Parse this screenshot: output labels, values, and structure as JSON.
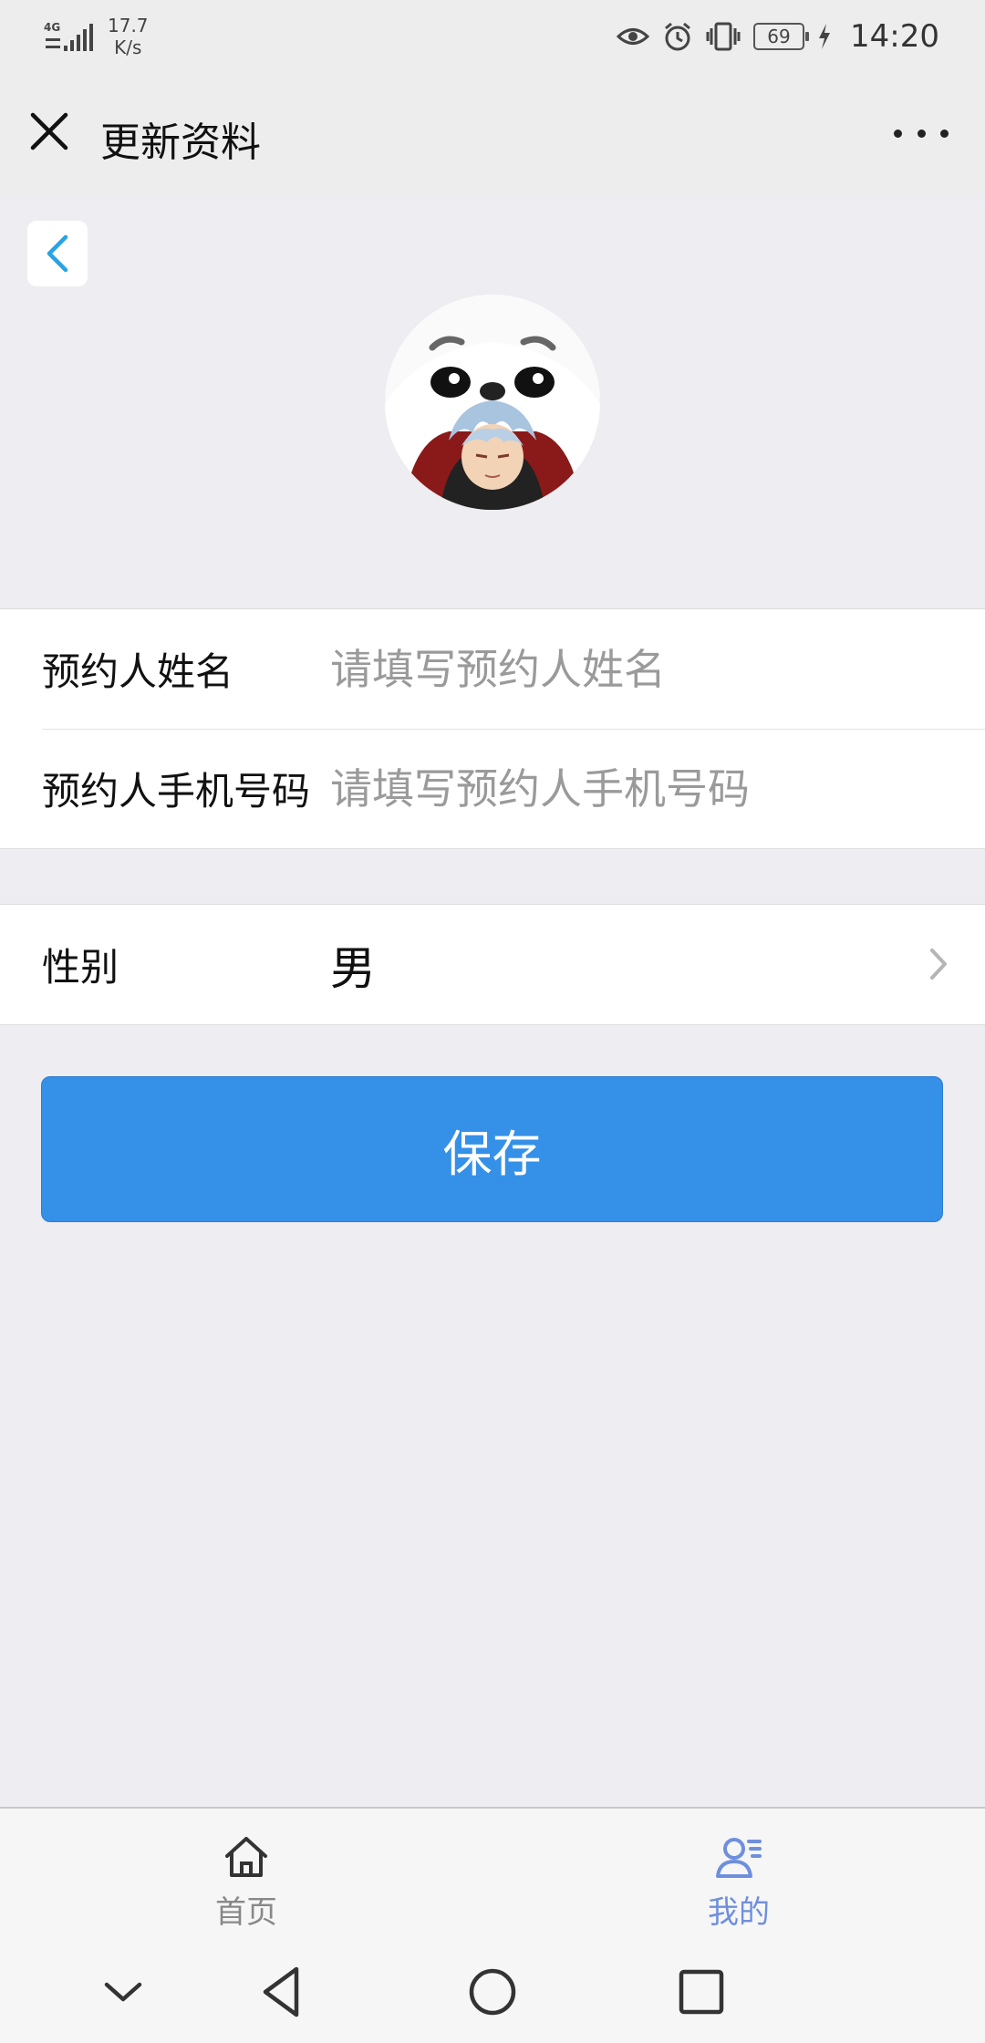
{
  "status_bar": {
    "network": "4G",
    "net_speed_value": "17.7",
    "net_speed_unit": "K/s",
    "battery": "69",
    "time": "14:20"
  },
  "title_bar": {
    "title": "更新资料"
  },
  "form": {
    "name_label": "预约人姓名",
    "name_placeholder": "请填写预约人姓名",
    "phone_label": "预约人手机号码",
    "phone_placeholder": "请填写预约人手机号码",
    "gender_label": "性别",
    "gender_value": "男"
  },
  "actions": {
    "save_label": "保存"
  },
  "tab_bar": {
    "tabs": [
      {
        "label": "首页",
        "icon": "home-icon",
        "active": false
      },
      {
        "label": "我的",
        "icon": "profile-icon",
        "active": true
      }
    ]
  },
  "colors": {
    "primary_button": "#3590e8",
    "active_tab": "#6f8fdd",
    "back_arrow": "#29a3e3"
  }
}
